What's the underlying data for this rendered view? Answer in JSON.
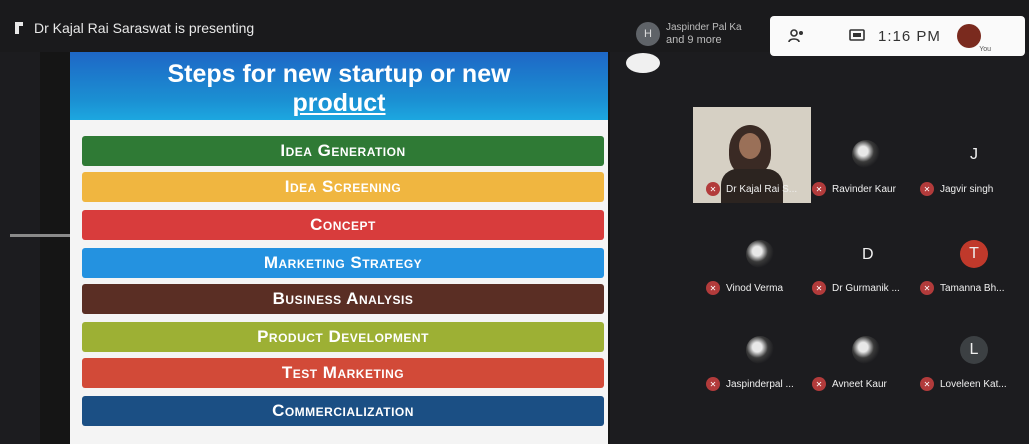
{
  "presenter": {
    "text": "Dr Kajal Rai Saraswat is presenting"
  },
  "others": {
    "avatar_letter": "H",
    "name": "Jaspinder Pal Ka",
    "more": "and 9 more"
  },
  "controls": {
    "time": "1:16 PM",
    "you_label": "You"
  },
  "slide": {
    "title_line1": "Steps for new startup or new",
    "title_line2": "product",
    "steps": [
      {
        "label": "Idea Generation",
        "color": "#2f7a35"
      },
      {
        "label": "Idea Screening",
        "color": "#f0b640"
      },
      {
        "label": "Concept",
        "color": "#d83c3c"
      },
      {
        "label": "Marketing Strategy",
        "color": "#2492e0"
      },
      {
        "label": "Business Analysis",
        "color": "#5a2e24"
      },
      {
        "label": "Product Development",
        "color": "#9db034"
      },
      {
        "label": "Test Marketing",
        "color": "#d24a38"
      },
      {
        "label": "Commercialization",
        "color": "#1b4f84"
      }
    ]
  },
  "participants": [
    {
      "name": "Dr Kajal Rai S...",
      "type": "video"
    },
    {
      "name": "Ravinder Kaur",
      "type": "image"
    },
    {
      "name": "Jagvir singh",
      "type": "letter",
      "letter": "J"
    },
    {
      "name": "Vinod Verma",
      "type": "image"
    },
    {
      "name": "Dr Gurmanik ...",
      "type": "letter",
      "letter": "D"
    },
    {
      "name": "Tamanna Bh...",
      "type": "avatar",
      "letter": "T",
      "color": "#c0392b"
    },
    {
      "name": "Jaspinderpal ...",
      "type": "image"
    },
    {
      "name": "Avneet Kaur",
      "type": "image"
    },
    {
      "name": "Loveleen Kat...",
      "type": "avatar",
      "letter": "L",
      "color": "#3c4043"
    }
  ]
}
